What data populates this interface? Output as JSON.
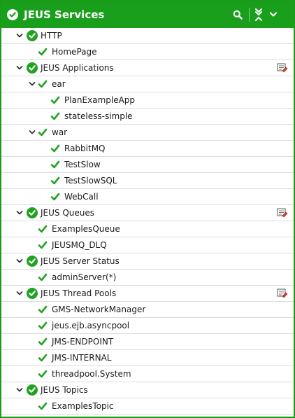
{
  "header": {
    "title": "JEUS Services"
  },
  "colors": {
    "header_bg": "#1a9f1d",
    "ok_green": "#1fa320",
    "border": "#1a9c1a"
  },
  "tree": [
    {
      "label": "HTTP",
      "level": 0,
      "kind": "group",
      "expanded": true,
      "editable": false
    },
    {
      "label": "HomePage",
      "level": 1,
      "kind": "leaf"
    },
    {
      "label": "JEUS Applications",
      "level": 0,
      "kind": "group",
      "expanded": true,
      "editable": true
    },
    {
      "label": "ear",
      "level": 1,
      "kind": "folder",
      "expanded": true
    },
    {
      "label": "PlanExampleApp",
      "level": 2,
      "kind": "leaf"
    },
    {
      "label": "stateless-simple",
      "level": 2,
      "kind": "leaf"
    },
    {
      "label": "war",
      "level": 1,
      "kind": "folder",
      "expanded": true
    },
    {
      "label": "RabbitMQ",
      "level": 2,
      "kind": "leaf"
    },
    {
      "label": "TestSlow",
      "level": 2,
      "kind": "leaf"
    },
    {
      "label": "TestSlowSQL",
      "level": 2,
      "kind": "leaf"
    },
    {
      "label": "WebCall",
      "level": 2,
      "kind": "leaf"
    },
    {
      "label": "JEUS Queues",
      "level": 0,
      "kind": "group",
      "expanded": true,
      "editable": true
    },
    {
      "label": "ExamplesQueue",
      "level": 1,
      "kind": "leaf"
    },
    {
      "label": "JEUSMQ_DLQ",
      "level": 1,
      "kind": "leaf"
    },
    {
      "label": "JEUS Server Status",
      "level": 0,
      "kind": "group",
      "expanded": true,
      "editable": false
    },
    {
      "label": "adminServer(*)",
      "level": 1,
      "kind": "leaf"
    },
    {
      "label": "JEUS Thread Pools",
      "level": 0,
      "kind": "group",
      "expanded": true,
      "editable": true
    },
    {
      "label": "GMS-NetworkManager",
      "level": 1,
      "kind": "leaf"
    },
    {
      "label": "jeus.ejb.asyncpool",
      "level": 1,
      "kind": "leaf"
    },
    {
      "label": "JMS-ENDPOINT",
      "level": 1,
      "kind": "leaf"
    },
    {
      "label": "JMS-INTERNAL",
      "level": 1,
      "kind": "leaf"
    },
    {
      "label": "threadpool.System",
      "level": 1,
      "kind": "leaf"
    },
    {
      "label": "JEUS Topics",
      "level": 0,
      "kind": "group",
      "expanded": true,
      "editable": false
    },
    {
      "label": "ExamplesTopic",
      "level": 1,
      "kind": "leaf"
    }
  ]
}
